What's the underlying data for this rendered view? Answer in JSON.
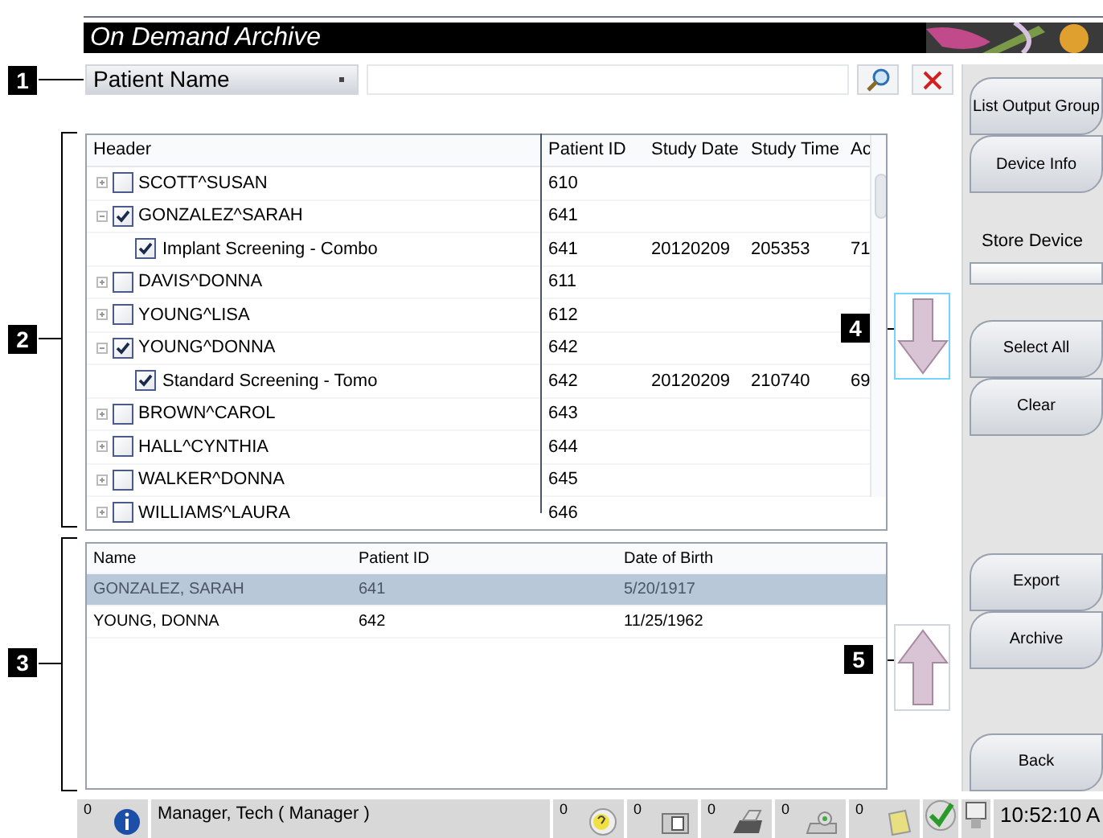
{
  "window": {
    "title": "On Demand Archive"
  },
  "callouts": [
    "1",
    "2",
    "3",
    "4",
    "5"
  ],
  "search": {
    "field_selector": "Patient Name"
  },
  "tree": {
    "columns": [
      "Header",
      "Patient ID",
      "Study Date",
      "Study Time",
      "Ac"
    ],
    "rows": [
      {
        "label": "SCOTT^SUSAN",
        "checked": false,
        "expanded": false,
        "patient_id": "610",
        "children": []
      },
      {
        "label": "GONZALEZ^SARAH",
        "checked": true,
        "expanded": true,
        "patient_id": "641",
        "children": [
          {
            "label": "Implant Screening - Combo",
            "checked": true,
            "patient_id": "641",
            "study_date": "20120209",
            "study_time": "205353",
            "column_5": "71"
          }
        ]
      },
      {
        "label": "DAVIS^DONNA",
        "checked": false,
        "expanded": false,
        "patient_id": "611",
        "children": []
      },
      {
        "label": "YOUNG^LISA",
        "checked": false,
        "expanded": false,
        "patient_id": "612",
        "children": []
      },
      {
        "label": "YOUNG^DONNA",
        "checked": true,
        "expanded": true,
        "patient_id": "642",
        "children": [
          {
            "label": "Standard Screening - Tomo",
            "checked": true,
            "patient_id": "642",
            "study_date": "20120209",
            "study_time": "210740",
            "column_5": "69"
          }
        ]
      },
      {
        "label": "BROWN^CAROL",
        "checked": false,
        "expanded": false,
        "patient_id": "643",
        "children": []
      },
      {
        "label": "HALL^CYNTHIA",
        "checked": false,
        "expanded": false,
        "patient_id": "644",
        "children": []
      },
      {
        "label": "WALKER^DONNA",
        "checked": false,
        "expanded": false,
        "patient_id": "645",
        "children": []
      },
      {
        "label": "WILLIAMS^LAURA",
        "checked": false,
        "expanded": false,
        "patient_id": "646",
        "children": []
      }
    ]
  },
  "selected_table": {
    "columns": [
      "Name",
      "Patient ID",
      "Date of Birth"
    ],
    "rows": [
      {
        "cells": [
          "GONZALEZ, SARAH",
          "641",
          "5/20/1917"
        ],
        "selected": true
      },
      {
        "cells": [
          "YOUNG, DONNA",
          "642",
          "11/25/1962"
        ],
        "selected": false
      }
    ]
  },
  "side_panel": {
    "top_buttons": [
      "List Output Group",
      "Device Info"
    ],
    "store_device_label": "Store Device",
    "select_buttons": [
      "Select All",
      "Clear"
    ],
    "action_buttons": [
      "Export",
      "Archive"
    ],
    "back_button": "Back"
  },
  "status_bar": {
    "items": [
      {
        "kind": "info",
        "count": "0"
      },
      {
        "kind": "user",
        "text": "Manager, Tech ( Manager )"
      },
      {
        "kind": "help",
        "count": "0"
      },
      {
        "kind": "scanner",
        "count": "0"
      },
      {
        "kind": "printer",
        "count": "0"
      },
      {
        "kind": "device",
        "count": "0"
      },
      {
        "kind": "note",
        "count": "0"
      },
      {
        "kind": "check"
      },
      {
        "kind": "monitor"
      },
      {
        "kind": "clock",
        "text": "10:52:10 A"
      }
    ]
  }
}
